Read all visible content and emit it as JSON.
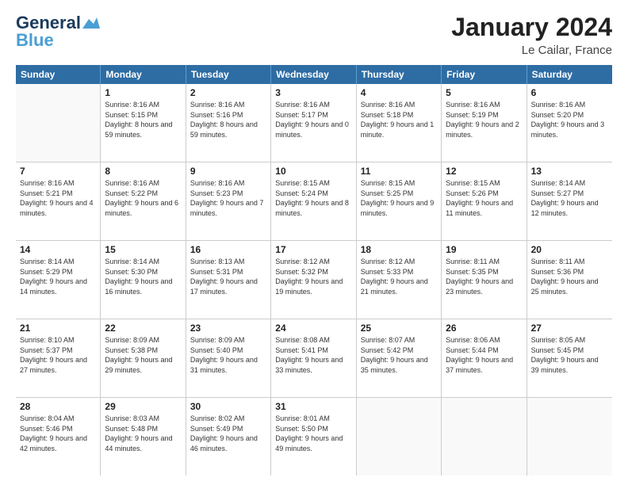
{
  "header": {
    "logo_line1": "General",
    "logo_line2": "Blue",
    "title": "January 2024",
    "subtitle": "Le Cailar, France"
  },
  "days_of_week": [
    "Sunday",
    "Monday",
    "Tuesday",
    "Wednesday",
    "Thursday",
    "Friday",
    "Saturday"
  ],
  "weeks": [
    [
      {
        "day": "",
        "sunrise": "",
        "sunset": "",
        "daylight": "",
        "empty": true
      },
      {
        "day": "1",
        "sunrise": "Sunrise: 8:16 AM",
        "sunset": "Sunset: 5:15 PM",
        "daylight": "Daylight: 8 hours and 59 minutes."
      },
      {
        "day": "2",
        "sunrise": "Sunrise: 8:16 AM",
        "sunset": "Sunset: 5:16 PM",
        "daylight": "Daylight: 8 hours and 59 minutes."
      },
      {
        "day": "3",
        "sunrise": "Sunrise: 8:16 AM",
        "sunset": "Sunset: 5:17 PM",
        "daylight": "Daylight: 9 hours and 0 minutes."
      },
      {
        "day": "4",
        "sunrise": "Sunrise: 8:16 AM",
        "sunset": "Sunset: 5:18 PM",
        "daylight": "Daylight: 9 hours and 1 minute."
      },
      {
        "day": "5",
        "sunrise": "Sunrise: 8:16 AM",
        "sunset": "Sunset: 5:19 PM",
        "daylight": "Daylight: 9 hours and 2 minutes."
      },
      {
        "day": "6",
        "sunrise": "Sunrise: 8:16 AM",
        "sunset": "Sunset: 5:20 PM",
        "daylight": "Daylight: 9 hours and 3 minutes."
      }
    ],
    [
      {
        "day": "7",
        "sunrise": "Sunrise: 8:16 AM",
        "sunset": "Sunset: 5:21 PM",
        "daylight": "Daylight: 9 hours and 4 minutes."
      },
      {
        "day": "8",
        "sunrise": "Sunrise: 8:16 AM",
        "sunset": "Sunset: 5:22 PM",
        "daylight": "Daylight: 9 hours and 6 minutes."
      },
      {
        "day": "9",
        "sunrise": "Sunrise: 8:16 AM",
        "sunset": "Sunset: 5:23 PM",
        "daylight": "Daylight: 9 hours and 7 minutes."
      },
      {
        "day": "10",
        "sunrise": "Sunrise: 8:15 AM",
        "sunset": "Sunset: 5:24 PM",
        "daylight": "Daylight: 9 hours and 8 minutes."
      },
      {
        "day": "11",
        "sunrise": "Sunrise: 8:15 AM",
        "sunset": "Sunset: 5:25 PM",
        "daylight": "Daylight: 9 hours and 9 minutes."
      },
      {
        "day": "12",
        "sunrise": "Sunrise: 8:15 AM",
        "sunset": "Sunset: 5:26 PM",
        "daylight": "Daylight: 9 hours and 11 minutes."
      },
      {
        "day": "13",
        "sunrise": "Sunrise: 8:14 AM",
        "sunset": "Sunset: 5:27 PM",
        "daylight": "Daylight: 9 hours and 12 minutes."
      }
    ],
    [
      {
        "day": "14",
        "sunrise": "Sunrise: 8:14 AM",
        "sunset": "Sunset: 5:29 PM",
        "daylight": "Daylight: 9 hours and 14 minutes."
      },
      {
        "day": "15",
        "sunrise": "Sunrise: 8:14 AM",
        "sunset": "Sunset: 5:30 PM",
        "daylight": "Daylight: 9 hours and 16 minutes."
      },
      {
        "day": "16",
        "sunrise": "Sunrise: 8:13 AM",
        "sunset": "Sunset: 5:31 PM",
        "daylight": "Daylight: 9 hours and 17 minutes."
      },
      {
        "day": "17",
        "sunrise": "Sunrise: 8:12 AM",
        "sunset": "Sunset: 5:32 PM",
        "daylight": "Daylight: 9 hours and 19 minutes."
      },
      {
        "day": "18",
        "sunrise": "Sunrise: 8:12 AM",
        "sunset": "Sunset: 5:33 PM",
        "daylight": "Daylight: 9 hours and 21 minutes."
      },
      {
        "day": "19",
        "sunrise": "Sunrise: 8:11 AM",
        "sunset": "Sunset: 5:35 PM",
        "daylight": "Daylight: 9 hours and 23 minutes."
      },
      {
        "day": "20",
        "sunrise": "Sunrise: 8:11 AM",
        "sunset": "Sunset: 5:36 PM",
        "daylight": "Daylight: 9 hours and 25 minutes."
      }
    ],
    [
      {
        "day": "21",
        "sunrise": "Sunrise: 8:10 AM",
        "sunset": "Sunset: 5:37 PM",
        "daylight": "Daylight: 9 hours and 27 minutes."
      },
      {
        "day": "22",
        "sunrise": "Sunrise: 8:09 AM",
        "sunset": "Sunset: 5:38 PM",
        "daylight": "Daylight: 9 hours and 29 minutes."
      },
      {
        "day": "23",
        "sunrise": "Sunrise: 8:09 AM",
        "sunset": "Sunset: 5:40 PM",
        "daylight": "Daylight: 9 hours and 31 minutes."
      },
      {
        "day": "24",
        "sunrise": "Sunrise: 8:08 AM",
        "sunset": "Sunset: 5:41 PM",
        "daylight": "Daylight: 9 hours and 33 minutes."
      },
      {
        "day": "25",
        "sunrise": "Sunrise: 8:07 AM",
        "sunset": "Sunset: 5:42 PM",
        "daylight": "Daylight: 9 hours and 35 minutes."
      },
      {
        "day": "26",
        "sunrise": "Sunrise: 8:06 AM",
        "sunset": "Sunset: 5:44 PM",
        "daylight": "Daylight: 9 hours and 37 minutes."
      },
      {
        "day": "27",
        "sunrise": "Sunrise: 8:05 AM",
        "sunset": "Sunset: 5:45 PM",
        "daylight": "Daylight: 9 hours and 39 minutes."
      }
    ],
    [
      {
        "day": "28",
        "sunrise": "Sunrise: 8:04 AM",
        "sunset": "Sunset: 5:46 PM",
        "daylight": "Daylight: 9 hours and 42 minutes."
      },
      {
        "day": "29",
        "sunrise": "Sunrise: 8:03 AM",
        "sunset": "Sunset: 5:48 PM",
        "daylight": "Daylight: 9 hours and 44 minutes."
      },
      {
        "day": "30",
        "sunrise": "Sunrise: 8:02 AM",
        "sunset": "Sunset: 5:49 PM",
        "daylight": "Daylight: 9 hours and 46 minutes."
      },
      {
        "day": "31",
        "sunrise": "Sunrise: 8:01 AM",
        "sunset": "Sunset: 5:50 PM",
        "daylight": "Daylight: 9 hours and 49 minutes."
      },
      {
        "day": "",
        "sunrise": "",
        "sunset": "",
        "daylight": "",
        "empty": true
      },
      {
        "day": "",
        "sunrise": "",
        "sunset": "",
        "daylight": "",
        "empty": true
      },
      {
        "day": "",
        "sunrise": "",
        "sunset": "",
        "daylight": "",
        "empty": true
      }
    ]
  ]
}
